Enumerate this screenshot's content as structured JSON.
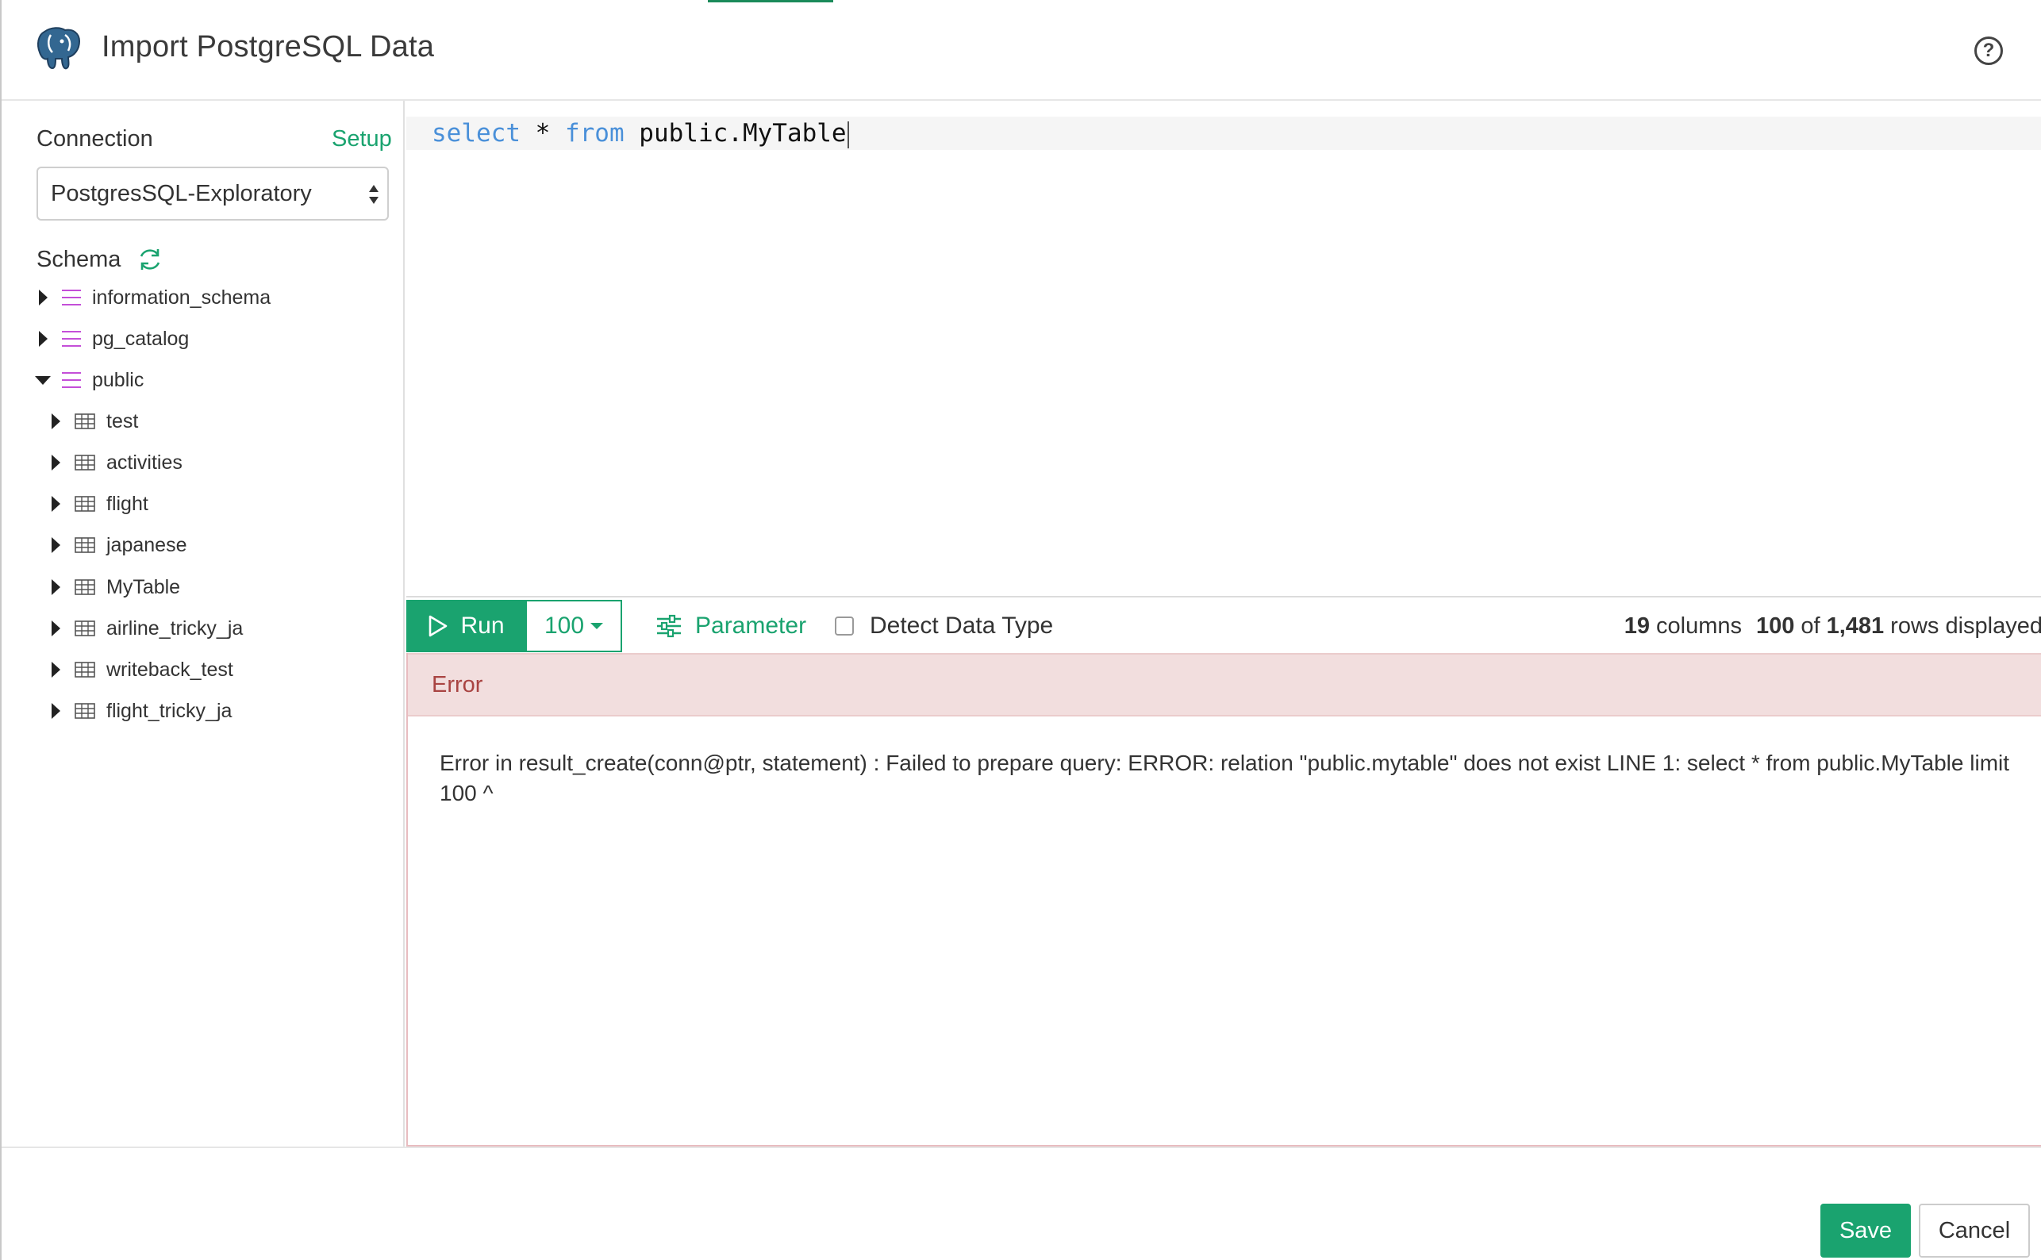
{
  "header": {
    "title": "Import PostgreSQL Data",
    "logo_icon": "postgresql-elephant-icon",
    "help_icon": "question-circle-icon",
    "help_label": "?"
  },
  "sidebar": {
    "connection_label": "Connection",
    "setup_label": "Setup",
    "connection_value": "PostgresSQL-Exploratory",
    "schema_label": "Schema",
    "schemas": [
      {
        "label": "information_schema",
        "expanded": false
      },
      {
        "label": "pg_catalog",
        "expanded": false
      },
      {
        "label": "public",
        "expanded": true
      }
    ],
    "tables": [
      {
        "label": "test"
      },
      {
        "label": "activities"
      },
      {
        "label": "flight"
      },
      {
        "label": "japanese"
      },
      {
        "label": "MyTable"
      },
      {
        "label": "airline_tricky_ja"
      },
      {
        "label": "writeback_test"
      },
      {
        "label": "flight_tricky_ja"
      }
    ]
  },
  "editor": {
    "kw_select": "select",
    "star": " * ",
    "kw_from": "from",
    "rest": " public.MyTable"
  },
  "toolbar": {
    "run_label": "Run",
    "limit_value": "100",
    "parameter_label": "Parameter",
    "detect_label": "Detect Data Type",
    "detect_checked": false,
    "columns_count": "19",
    "columns_word": "columns",
    "rows_shown": "100",
    "of_word": "of",
    "rows_total": "1,481",
    "rows_word": "rows displayed"
  },
  "error": {
    "title": "Error",
    "message": "Error in result_create(conn@ptr, statement) : Failed to prepare query: ERROR: relation \"public.mytable\" does not exist LINE 1: select * from public.MyTable limit 100 ^"
  },
  "footer": {
    "save_label": "Save",
    "cancel_label": "Cancel"
  },
  "colors": {
    "accent": "#1aa36f",
    "keyword": "#4a90d9",
    "schema_icon": "#c44fd8",
    "error_bg": "#f2dede",
    "error_text": "#a94442"
  }
}
